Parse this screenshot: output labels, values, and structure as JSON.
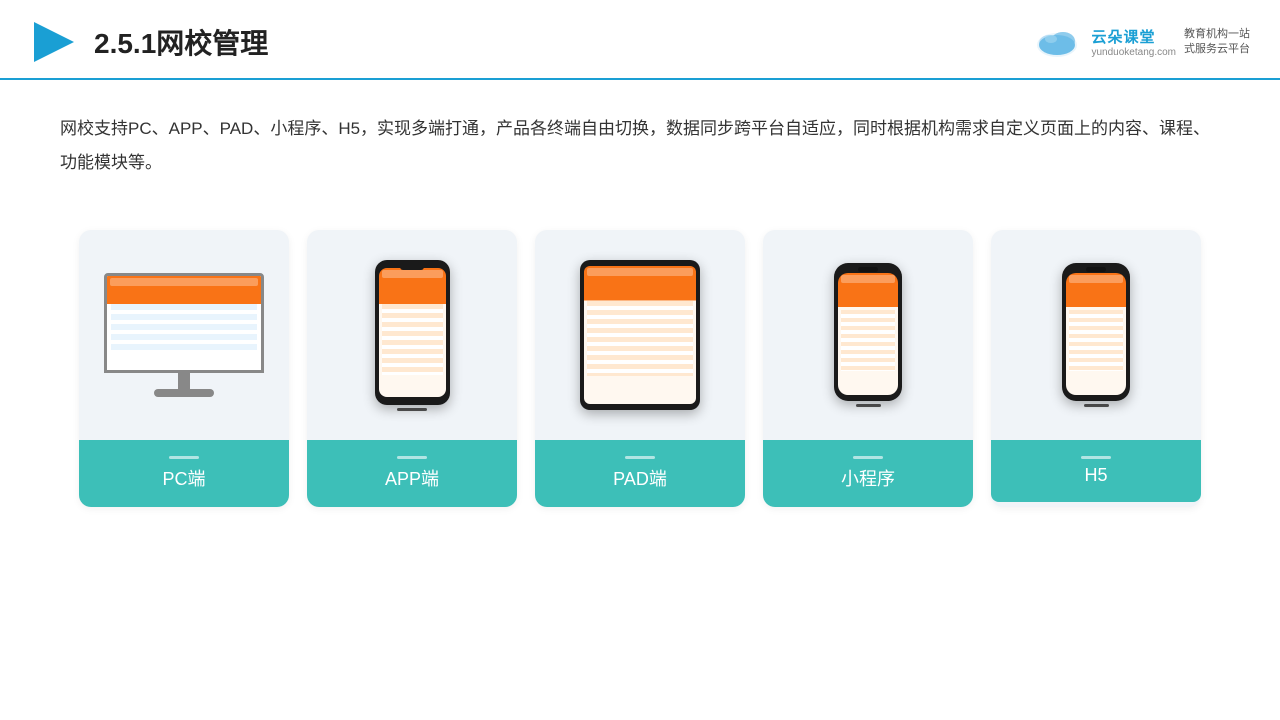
{
  "header": {
    "title": "2.5.1网校管理",
    "logo": {
      "name": "云朵课堂",
      "url": "yunduoketang.com",
      "tagline": "教育机构一站\n式服务云平台"
    }
  },
  "description": {
    "text": "网校支持PC、APP、PAD、小程序、H5，实现多端打通，产品各终端自由切换，数据同步跨平台自适应，同时根据机构需求自定义页面上的内容、课程、功能模块等。"
  },
  "cards": [
    {
      "id": "pc",
      "label": "PC端"
    },
    {
      "id": "app",
      "label": "APP端"
    },
    {
      "id": "pad",
      "label": "PAD端"
    },
    {
      "id": "miniprogram",
      "label": "小程序"
    },
    {
      "id": "h5",
      "label": "H5"
    }
  ],
  "accent_color": "#3dbfb8"
}
